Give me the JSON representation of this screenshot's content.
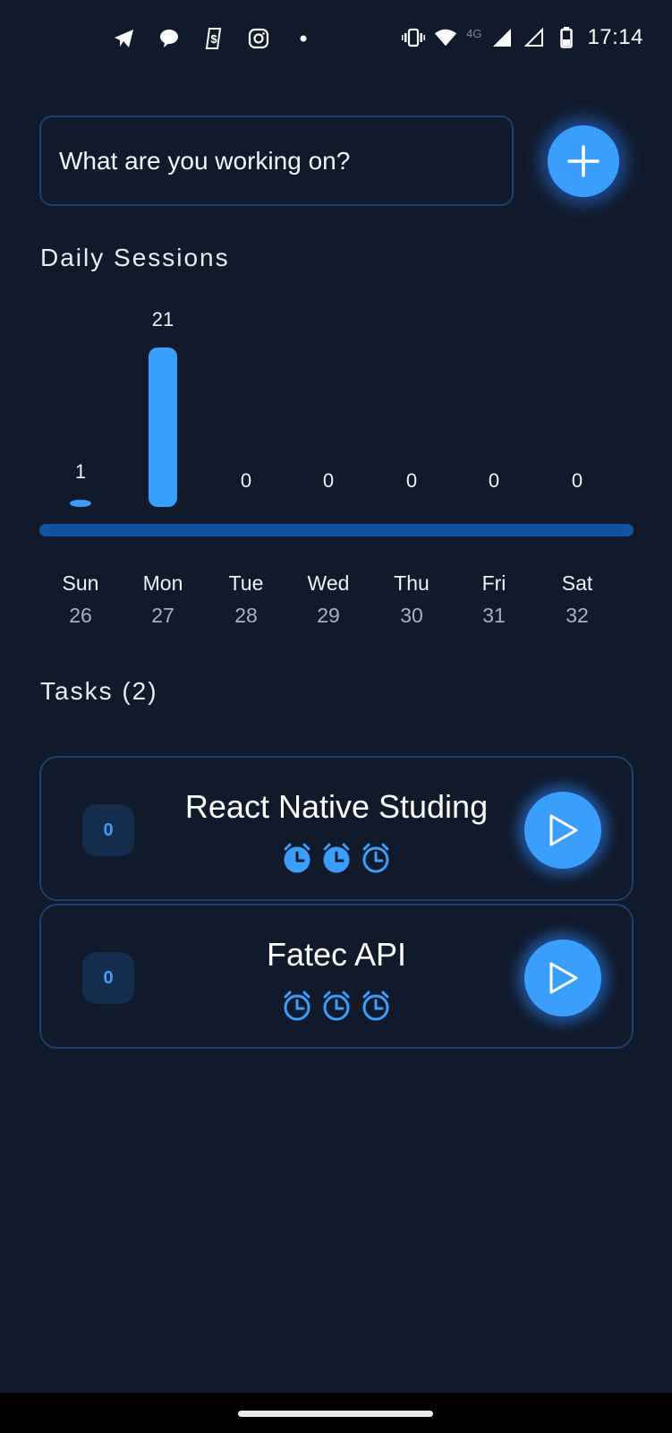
{
  "status_bar": {
    "time": "17:14",
    "network_label": "4G",
    "left_icons": [
      "telegram-icon",
      "chat-bubble-icon",
      "money-app-icon",
      "instagram-icon",
      "notification-dot-icon"
    ],
    "right_icons": [
      "vibrate-icon",
      "wifi-icon",
      "signal-full-icon",
      "signal-empty-icon",
      "battery-icon"
    ]
  },
  "new_task": {
    "placeholder": "What are you working on?",
    "value": "",
    "add_button_icon": "plus-icon"
  },
  "daily_sessions": {
    "title": "Daily Sessions"
  },
  "chart_data": {
    "type": "bar",
    "title": "Daily Sessions",
    "categories": [
      "Sun",
      "Mon",
      "Tue",
      "Wed",
      "Thu",
      "Fri",
      "Sat"
    ],
    "day_numbers": [
      "26",
      "27",
      "28",
      "29",
      "30",
      "31",
      "32"
    ],
    "values": [
      1,
      21,
      0,
      0,
      0,
      0,
      0
    ],
    "value_labels": [
      "1",
      "21",
      "0",
      "0",
      "0",
      "0",
      "0"
    ],
    "xlabel": "",
    "ylabel": "",
    "ylim": [
      0,
      21
    ],
    "grid": false,
    "legend": "none",
    "bar_color": "#3a9efc",
    "baseline_color": "#0d55a3"
  },
  "tasks": {
    "title": "Tasks (2)",
    "items": [
      {
        "name": "React Native Studing",
        "count": "0",
        "pomodoros_total": 3,
        "pomodoros_done": 2
      },
      {
        "name": "Fatec API",
        "count": "0",
        "pomodoros_total": 3,
        "pomodoros_done": 0
      }
    ]
  },
  "colors": {
    "background": "#111a2b",
    "accent": "#3a9efc",
    "border": "#1c3f6c"
  }
}
